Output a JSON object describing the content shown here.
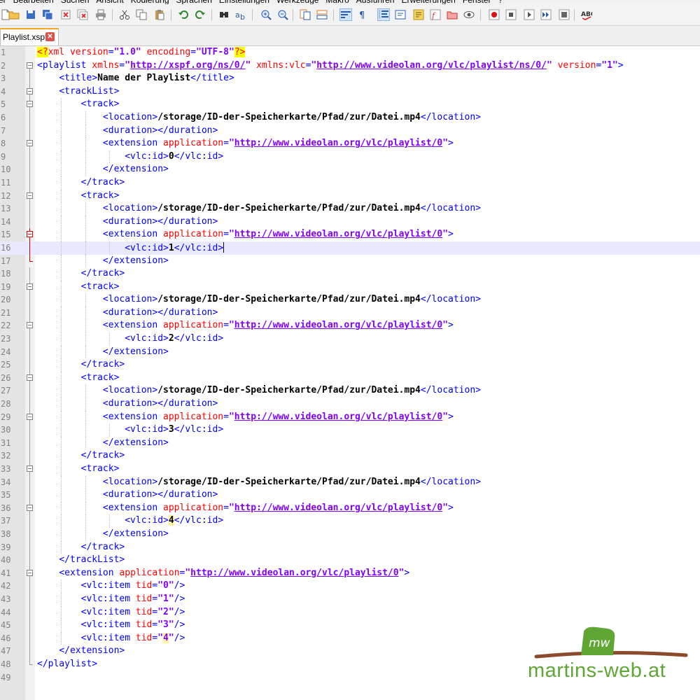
{
  "menu": [
    "iter",
    "Bearbeiten",
    "Suchen",
    "Ansicht",
    "Kodierung",
    "Sprachen",
    "Einstellungen",
    "Werkzeuge",
    "Makro",
    "Ausführen",
    "Erweiterungen",
    "Fenster",
    "?"
  ],
  "toolbar": {
    "icons": [
      "new-file-icon",
      "open-file-icon",
      "save-icon",
      "save-all-icon",
      "close-icon",
      "close-all-icon",
      "print-icon",
      "cut-icon",
      "copy-icon",
      "paste-icon",
      "undo-icon",
      "redo-icon",
      "find-icon",
      "replace-icon",
      "zoom-in-icon",
      "zoom-out-icon",
      "sync-vertical-icon",
      "sync-horizontal-icon",
      "word-wrap-icon",
      "show-all-characters-icon",
      "indent-guide-icon",
      "user-defined-language-icon",
      "document-map-icon",
      "function-list-icon",
      "folder-as-workspace-icon",
      "monitoring-icon",
      "record-macro-icon",
      "stop-recording-icon",
      "play-macro-icon",
      "run-macro-multiple-icon",
      "save-macro-icon",
      "spell-check-icon"
    ],
    "spellcheck_label": "ABC"
  },
  "tab": {
    "label": "Playlist.xspf",
    "close_glyph": "✕"
  },
  "editor": {
    "current_line": 16,
    "lines": [
      {
        "n": "1",
        "code": "<?xml version=\"1.0\" encoding=\"UTF-8\"?>"
      },
      {
        "n": "2",
        "code": "<playlist xmlns=\"http://xspf.org/ns/0/\" xmlns:vlc=\"http://www.videolan.org/vlc/playlist/ns/0/\" version=\"1\">"
      },
      {
        "n": "3",
        "code": "    <title>Name der Playlist</title>"
      },
      {
        "n": "4",
        "code": "    <trackList>"
      },
      {
        "n": "5",
        "code": "        <track>"
      },
      {
        "n": "6",
        "code": "            <location>/storage/ID-der-Speicherkarte/Pfad/zur/Datei.mp4</location>"
      },
      {
        "n": "7",
        "code": "            <duration></duration>"
      },
      {
        "n": "8",
        "code": "            <extension application=\"http://www.videolan.org/vlc/playlist/0\">"
      },
      {
        "n": "9",
        "code": "                <vlc:id>0</vlc:id>"
      },
      {
        "n": "10",
        "code": "            </extension>"
      },
      {
        "n": "11",
        "code": "        </track>"
      },
      {
        "n": "12",
        "code": "        <track>"
      },
      {
        "n": "13",
        "code": "            <location>/storage/ID-der-Speicherkarte/Pfad/zur/Datei.mp4</location>"
      },
      {
        "n": "14",
        "code": "            <duration></duration>"
      },
      {
        "n": "15",
        "code": "            <extension application=\"http://www.videolan.org/vlc/playlist/0\">"
      },
      {
        "n": "16",
        "code": "                <vlc:id>1</vlc:id>"
      },
      {
        "n": "17",
        "code": "            </extension>"
      },
      {
        "n": "18",
        "code": "        </track>"
      },
      {
        "n": "19",
        "code": "        <track>"
      },
      {
        "n": "20",
        "code": "            <location>/storage/ID-der-Speicherkarte/Pfad/zur/Datei.mp4</location>"
      },
      {
        "n": "21",
        "code": "            <duration></duration>"
      },
      {
        "n": "22",
        "code": "            <extension application=\"http://www.videolan.org/vlc/playlist/0\">"
      },
      {
        "n": "23",
        "code": "                <vlc:id>2</vlc:id>"
      },
      {
        "n": "24",
        "code": "            </extension>"
      },
      {
        "n": "25",
        "code": "        </track>"
      },
      {
        "n": "26",
        "code": "        <track>"
      },
      {
        "n": "27",
        "code": "            <location>/storage/ID-der-Speicherkarte/Pfad/zur/Datei.mp4</location>"
      },
      {
        "n": "28",
        "code": "            <duration></duration>"
      },
      {
        "n": "29",
        "code": "            <extension application=\"http://www.videolan.org/vlc/playlist/0\">"
      },
      {
        "n": "30",
        "code": "                <vlc:id>3</vlc:id>"
      },
      {
        "n": "31",
        "code": "            </extension>"
      },
      {
        "n": "32",
        "code": "        </track>"
      },
      {
        "n": "33",
        "code": "        <track>"
      },
      {
        "n": "34",
        "code": "            <location>/storage/ID-der-Speicherkarte/Pfad/zur/Datei.mp4</location>"
      },
      {
        "n": "35",
        "code": "            <duration></duration>"
      },
      {
        "n": "36",
        "code": "            <extension application=\"http://www.videolan.org/vlc/playlist/0\">"
      },
      {
        "n": "37",
        "code": "                <vlc:id>4</vlc:id>"
      },
      {
        "n": "38",
        "code": "            </extension>"
      },
      {
        "n": "39",
        "code": "        </track>"
      },
      {
        "n": "40",
        "code": "    </trackList>"
      },
      {
        "n": "41",
        "code": "    <extension application=\"http://www.videolan.org/vlc/playlist/0\">"
      },
      {
        "n": "42",
        "code": "        <vlc:item tid=\"0\"/>"
      },
      {
        "n": "43",
        "code": "        <vlc:item tid=\"1\"/>"
      },
      {
        "n": "44",
        "code": "        <vlc:item tid=\"2\"/>"
      },
      {
        "n": "45",
        "code": "        <vlc:item tid=\"3\"/>"
      },
      {
        "n": "46",
        "code": "        <vlc:item tid=\"4\"/>"
      },
      {
        "n": "47",
        "code": "    </extension>"
      },
      {
        "n": "48",
        "code": "</playlist>"
      },
      {
        "n": "49",
        "code": ""
      }
    ]
  },
  "logo": {
    "text": "martins-web.at",
    "badge": "mw",
    "colors": {
      "green": "#5fa634",
      "brown": "#8b4a2b"
    }
  },
  "colors": {
    "tag": "#0000ff",
    "attribute": "#ff0000",
    "value": "#8000ff",
    "text": "#000000",
    "xml_decl_bg": "#ffff00",
    "current_line_bg": "#e8e8ff",
    "gutter_bg": "#e4e4e4"
  }
}
